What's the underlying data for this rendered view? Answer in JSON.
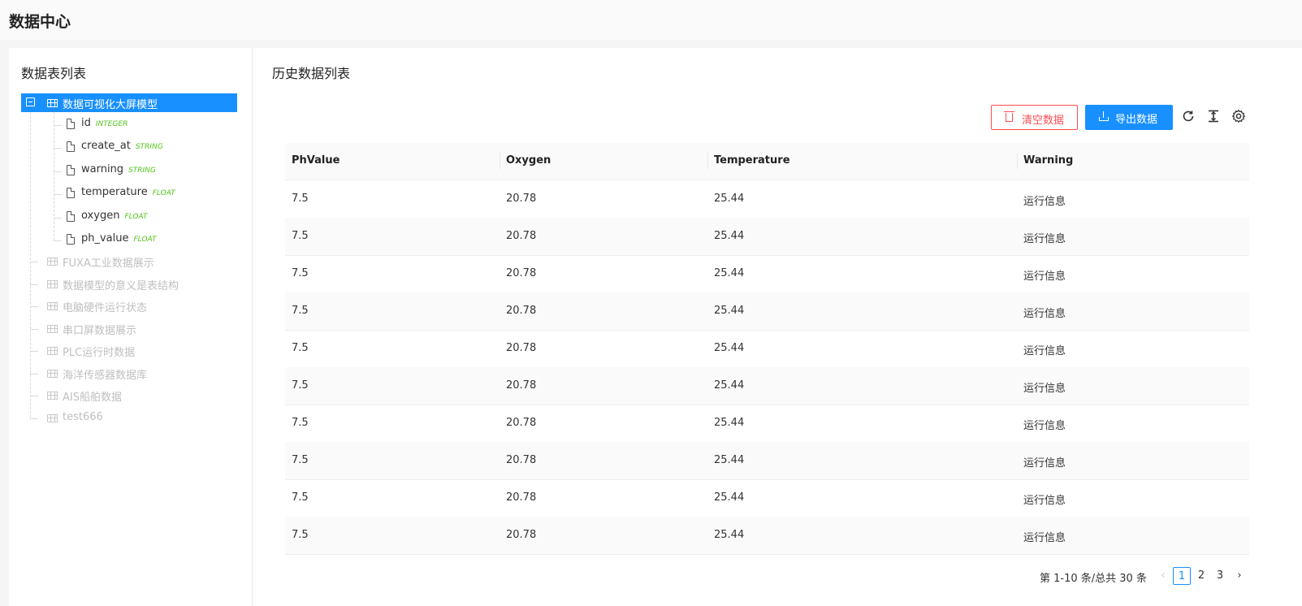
{
  "app": {
    "title": "数据中心"
  },
  "left_panel": {
    "title": "数据表列表",
    "tree": {
      "root": {
        "label": "数据可视化大屏模型",
        "fields": [
          {
            "name": "id",
            "type": "INTEGER"
          },
          {
            "name": "create_at",
            "type": "STRING"
          },
          {
            "name": "warning",
            "type": "STRING"
          },
          {
            "name": "temperature",
            "type": "FLOAT"
          },
          {
            "name": "oxygen",
            "type": "FLOAT"
          },
          {
            "name": "ph_value",
            "type": "FLOAT"
          }
        ]
      },
      "others": [
        "FUXA工业数据展示",
        "数据模型的意义是表结构",
        "电脑硬件运行状态",
        "串口屏数据展示",
        "PLC运行时数据",
        "海洋传感器数据库",
        "AIS船舶数据",
        "test666"
      ]
    }
  },
  "right_panel": {
    "title": "历史数据列表",
    "toolbar": {
      "clear_label": "清空数据",
      "export_label": "导出数据",
      "icons": [
        "reload-icon",
        "column-height-icon",
        "setting-icon"
      ]
    },
    "table": {
      "columns": [
        "PhValue",
        "Oxygen",
        "Temperature",
        "Warning"
      ],
      "rows": [
        [
          "7.5",
          "20.78",
          "25.44",
          "运行信息"
        ],
        [
          "7.5",
          "20.78",
          "25.44",
          "运行信息"
        ],
        [
          "7.5",
          "20.78",
          "25.44",
          "运行信息"
        ],
        [
          "7.5",
          "20.78",
          "25.44",
          "运行信息"
        ],
        [
          "7.5",
          "20.78",
          "25.44",
          "运行信息"
        ],
        [
          "7.5",
          "20.78",
          "25.44",
          "运行信息"
        ],
        [
          "7.5",
          "20.78",
          "25.44",
          "运行信息"
        ],
        [
          "7.5",
          "20.78",
          "25.44",
          "运行信息"
        ],
        [
          "7.5",
          "20.78",
          "25.44",
          "运行信息"
        ],
        [
          "7.5",
          "20.78",
          "25.44",
          "运行信息"
        ]
      ]
    },
    "pagination": {
      "total_text": "第 1-10 条/总共 30 条",
      "pages": [
        "1",
        "2",
        "3"
      ],
      "current": "1"
    }
  },
  "colors": {
    "primary": "#1890ff",
    "danger": "#ff4d4f",
    "type_tag": "#52c41a"
  }
}
